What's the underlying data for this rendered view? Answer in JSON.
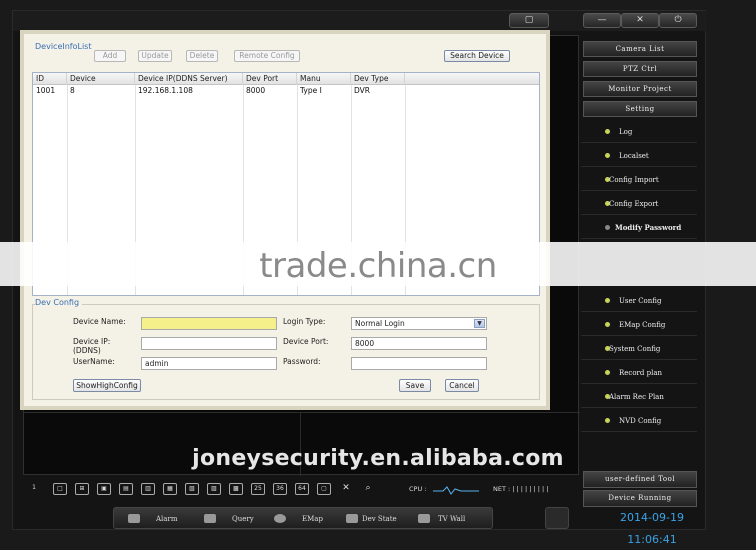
{
  "window": {
    "buttons": [
      "▢",
      "—",
      "✕",
      "⏻"
    ]
  },
  "right_panel": {
    "top_buttons": [
      "Camera List",
      "PTZ Ctrl",
      "Monitor Project",
      "Setting"
    ],
    "setting_items": [
      {
        "label": "Log",
        "dot": "yellow"
      },
      {
        "label": "Localset",
        "dot": "yellow"
      },
      {
        "label": "Config Import",
        "dot": "yellow"
      },
      {
        "label": "Config Export",
        "dot": "yellow"
      },
      {
        "label": "Modify Password",
        "dot": "grey"
      },
      {
        "label": "User Config",
        "dot": "yellow"
      },
      {
        "label": "EMap Config",
        "dot": "yellow"
      },
      {
        "label": "System Config",
        "dot": "yellow"
      },
      {
        "label": "Record plan",
        "dot": "yellow"
      },
      {
        "label": "Alarm Rec Plan",
        "dot": "yellow"
      },
      {
        "label": "NVD Config",
        "dot": "yellow"
      }
    ],
    "bottom_buttons": [
      "user-defined Tool",
      "Device Running"
    ]
  },
  "dialog": {
    "list_title": "DeviceInfoList",
    "buttons": {
      "add": "Add",
      "update": "Update",
      "delete": "Delete",
      "remote": "Remote Config",
      "search": "Search Device"
    },
    "table": {
      "headers": [
        "ID",
        "Device",
        "Device IP(DDNS Server)",
        "Dev Port",
        "Manu",
        "Dev Type"
      ],
      "rows": [
        [
          "1001",
          "8",
          "192.168.1.108",
          "8000",
          "Type I",
          "DVR"
        ]
      ]
    },
    "config": {
      "title": "Dev Config",
      "device_name_label": "Device Name:",
      "device_name_value": "",
      "device_ip_label": "Device IP:\n(DDNS)",
      "device_ip_value": "",
      "username_label": "UserName:",
      "username_value": "admin",
      "login_type_label": "Login Type:",
      "login_type_value": "Normal Login",
      "device_port_label": "Device Port:",
      "device_port_value": "8000",
      "password_label": "Password:",
      "password_value": "",
      "show_high": "ShowHighConfig",
      "save": "Save",
      "cancel": "Cancel"
    }
  },
  "toolbar": {
    "cpu_label": "CPU :",
    "net_label": "NET : | | | | | | | | |",
    "split_labels": [
      "1",
      "□",
      "⊞",
      "▣",
      "▤",
      "▥",
      "▦",
      "▧",
      "▨",
      "▩",
      "25",
      "36",
      "64",
      "▢",
      "✕",
      "⌕"
    ]
  },
  "bottombar": {
    "items": [
      "Alarm",
      "Query",
      "EMap",
      "Dev State",
      "TV Wall"
    ]
  },
  "status": {
    "datetime": "2014-09-19 11:06:41"
  },
  "watermarks": {
    "center": "trade.china.cn",
    "lower": "joneysecurity.en.alibaba.com"
  },
  "colors": {
    "accent_blue": "#3aa3e6",
    "section_title": "#3a6fb5",
    "device_name_field": "#f6f08a"
  }
}
